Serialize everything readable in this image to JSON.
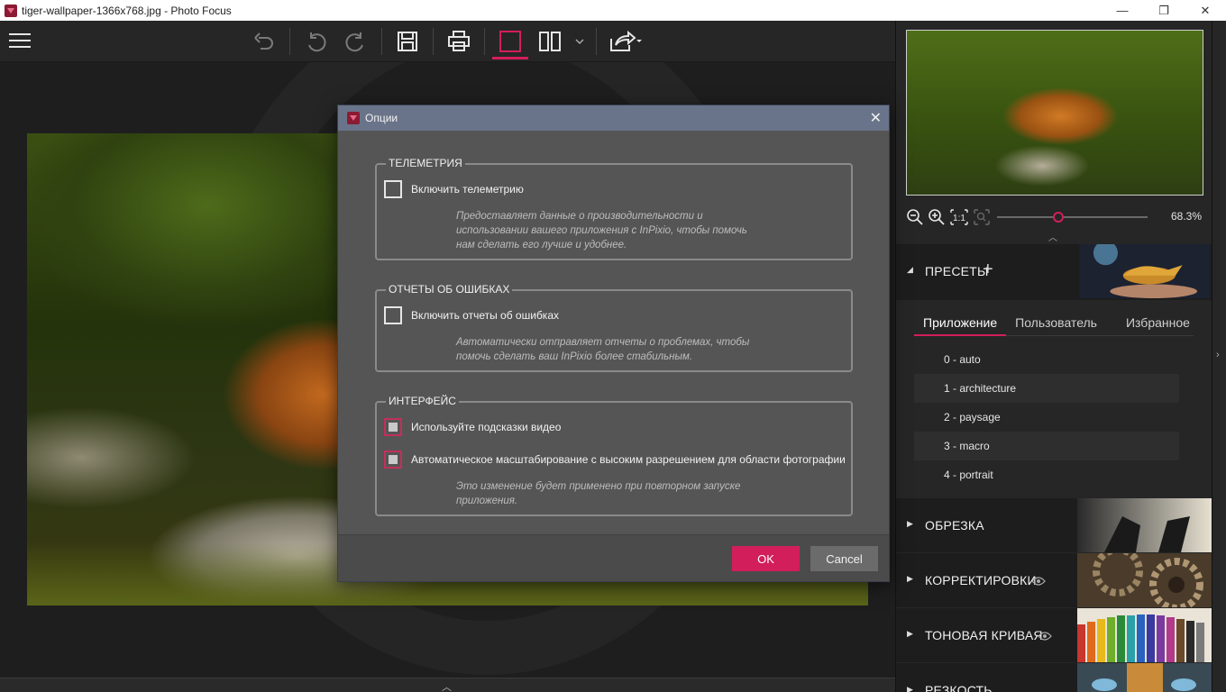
{
  "window": {
    "title": "tiger-wallpaper-1366x768.jpg - Photo Focus",
    "minimize_glyph": "—",
    "maximize_glyph": "❐",
    "close_glyph": "✕"
  },
  "toolbar": {
    "icons": [
      "menu-icon",
      "undo-icon",
      "undo-step-icon",
      "redo-icon",
      "save-icon",
      "print-icon",
      "single-view-icon",
      "compare-view-icon",
      "chevron-down-icon",
      "share-icon"
    ]
  },
  "colors": {
    "accent": "#d21e5a",
    "dialog_title_bar": "#69748a",
    "dialog_bg": "#555555",
    "panel_bg": "#262626"
  },
  "navigator": {
    "zoom_value": "68.3%",
    "zoom_slider_fraction": 0.41,
    "icons": [
      "zoom-out-icon",
      "zoom-in-icon",
      "actual-size-icon",
      "fit-icon"
    ]
  },
  "presets": {
    "title": "ПРЕСЕТЫ",
    "add_glyph": "+",
    "tabs": [
      {
        "label": "Приложение",
        "active": true
      },
      {
        "label": "Пользователь",
        "active": false
      },
      {
        "label": "Избранное",
        "active": false
      }
    ],
    "items": [
      {
        "label": "0 - auto"
      },
      {
        "label": "1 - architecture"
      },
      {
        "label": "2 - paysage"
      },
      {
        "label": "3 - macro"
      },
      {
        "label": "4 - portrait"
      }
    ]
  },
  "sections": [
    {
      "title": "ОБРЕЗКА"
    },
    {
      "title": "КОРРЕКТИРОВКИ"
    },
    {
      "title": "ТОНОВАЯ КРИВАЯ"
    },
    {
      "title": "РЕЗКОСТЬ"
    }
  ],
  "dialog": {
    "title": "Опции",
    "close_glyph": "✕",
    "telemetry": {
      "group_title": "ТЕЛЕМЕТРИЯ",
      "checkbox_label": "Включить телеметрию",
      "checked": false,
      "desc_lines": [
        "Предоставляет данные о производительности и",
        "использовании вашего приложения с InPixio, чтобы помочь",
        "нам сделать его лучше и удобнее."
      ]
    },
    "errors": {
      "group_title": "ОТЧЕТЫ ОБ ОШИБКАХ",
      "checkbox_label": "Включить отчеты об ошибках",
      "checked": false,
      "desc_lines": [
        "Автоматически отправляет отчеты о проблемах, чтобы",
        "помочь сделать ваш InPixio более стабильным."
      ]
    },
    "interface": {
      "group_title": "ИНТЕРФЕЙС",
      "video_hints_label": "Используйте подсказки видео",
      "hidpi_label": "Автоматическое масштабирование с высоким разрешением для области фотографии",
      "desc_lines": [
        "Это изменение будет применено при повторном запуске",
        "приложения."
      ]
    },
    "ok_label": "OK",
    "cancel_label": "Cancel"
  }
}
